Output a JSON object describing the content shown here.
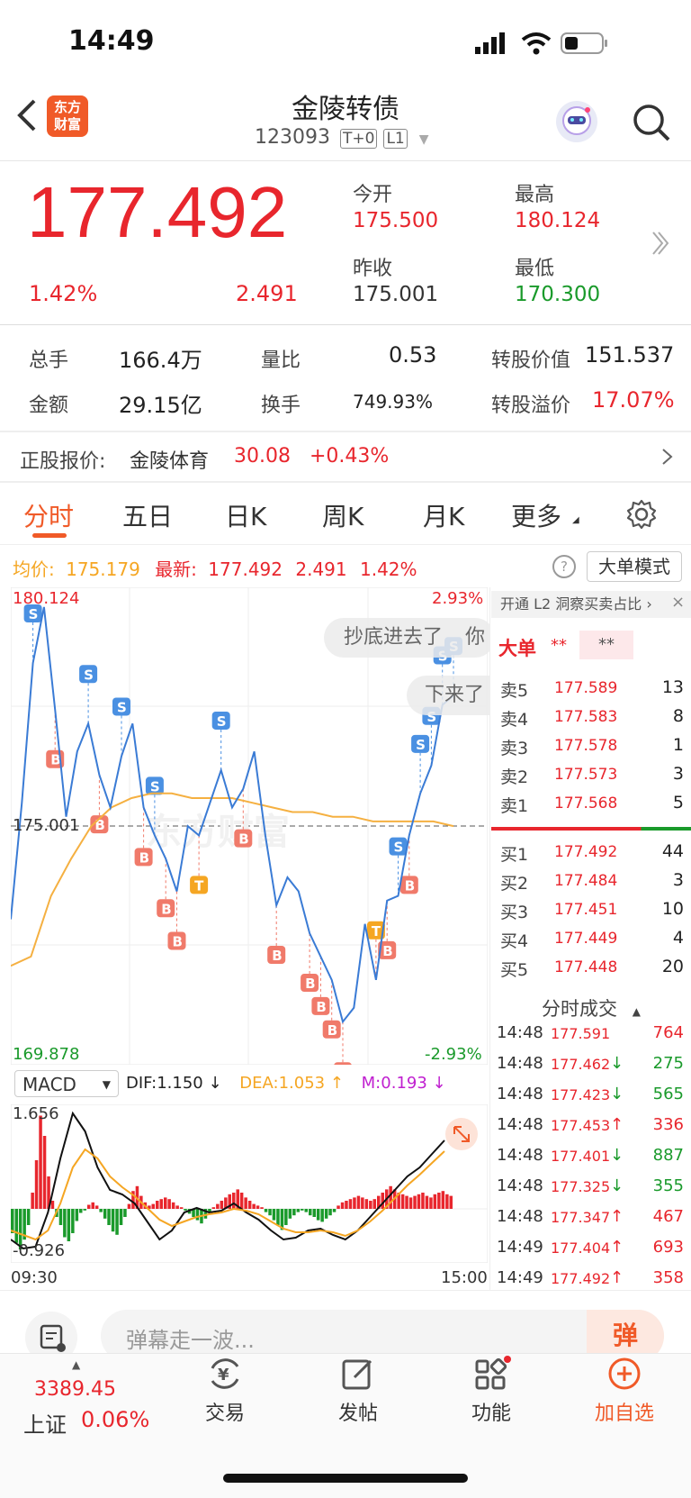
{
  "status_bar": {
    "time": "14:49"
  },
  "header": {
    "logo_line1": "东方",
    "logo_line2": "财富",
    "title": "金陵转债",
    "code": "123093",
    "tag1": "T+0",
    "tag2": "L1"
  },
  "quote": {
    "price": "177.492",
    "change_pct": "1.42%",
    "change": "2.491",
    "open_label": "今开",
    "open": "175.500",
    "high_label": "最高",
    "high": "180.124",
    "prev_label": "昨收",
    "prev": "175.001",
    "low_label": "最低",
    "low": "170.300"
  },
  "stats": {
    "vol_label": "总手",
    "vol": "166.4万",
    "ratio_label": "量比",
    "ratio": "0.53",
    "conv_value_label": "转股价值",
    "conv_value": "151.537",
    "amount_label": "金额",
    "amount": "29.15亿",
    "turnover_label": "换手",
    "turnover": "749.93%",
    "premium_label": "转股溢价",
    "premium": "17.07%"
  },
  "stock": {
    "label": "正股报价:",
    "name": "金陵体育",
    "price": "30.08",
    "change": "+0.43%"
  },
  "tabs": [
    "分时",
    "五日",
    "日K",
    "周K",
    "月K",
    "更多"
  ],
  "info_line": {
    "avg_label": "均价:",
    "avg": "175.179",
    "latest_label": "最新:",
    "latest": "177.492",
    "change": "2.491",
    "pct": "1.42%",
    "mode_button": "大单模式"
  },
  "chart_labels": {
    "top_price": "180.124",
    "top_pct": "2.93%",
    "mid_price": "175.001",
    "bottom_price": "169.878",
    "bottom_pct": "-2.93%",
    "danmu1": "抄底进去了",
    "danmu1_tail": "你",
    "danmu2": "下来了",
    "watermark": "东方财富"
  },
  "chart_data": {
    "type": "line",
    "title": "",
    "x_range": [
      "09:30",
      "15:00"
    ],
    "ylim": [
      169.878,
      180.124
    ],
    "prev_close": 175.001,
    "series": [
      {
        "name": "",
        "values": [
          173.0,
          175.5,
          178.5,
          179.7,
          177.5,
          175.2,
          176.6,
          177.2,
          176.1,
          175.4,
          176.5,
          177.2,
          175.4,
          174.8,
          174.3,
          173.6,
          175.0,
          174.8,
          175.5,
          176.2,
          175.4,
          175.8,
          176.6,
          174.8,
          173.3,
          173.9,
          173.6,
          172.7,
          172.2,
          171.7,
          170.8,
          171.1,
          172.9,
          171.7,
          173.4,
          173.5,
          174.8,
          175.7,
          176.3,
          177.6,
          177.8
        ]
      },
      {
        "name": "",
        "values": [
          172.0,
          172.2,
          173.5,
          174.3,
          175.0,
          175.4,
          175.6,
          175.7,
          175.7,
          175.6,
          175.6,
          175.6,
          175.5,
          175.4,
          175.3,
          175.3,
          175.2,
          175.2,
          175.1,
          175.1,
          175.1,
          175.1,
          175.0
        ]
      }
    ]
  },
  "macd": {
    "label": "MACD",
    "dif_label": "DIF:",
    "dif": "1.150",
    "dea_label": "DEA:",
    "dea": "1.053",
    "m_label": "M:",
    "m": "0.193",
    "top": "1.656",
    "bottom": "-0.926",
    "time_start": "09:30",
    "time_end": "15:00"
  },
  "orderbook": {
    "banner": "开通 L2 洞察买卖占比",
    "big_label": "大单",
    "big_val1": "**",
    "big_val2": "**",
    "asks": [
      {
        "label": "卖5",
        "price": "177.589",
        "vol": "13"
      },
      {
        "label": "卖4",
        "price": "177.583",
        "vol": "8"
      },
      {
        "label": "卖3",
        "price": "177.578",
        "vol": "1"
      },
      {
        "label": "卖2",
        "price": "177.573",
        "vol": "3"
      },
      {
        "label": "卖1",
        "price": "177.568",
        "vol": "5"
      }
    ],
    "bids": [
      {
        "label": "买1",
        "price": "177.492",
        "vol": "44"
      },
      {
        "label": "买2",
        "price": "177.484",
        "vol": "3"
      },
      {
        "label": "买3",
        "price": "177.451",
        "vol": "10"
      },
      {
        "label": "买4",
        "price": "177.449",
        "vol": "4"
      },
      {
        "label": "买5",
        "price": "177.448",
        "vol": "20"
      }
    ],
    "trades_title": "分时成交",
    "trades": [
      {
        "time": "14:48",
        "price": "177.591",
        "dir": "",
        "vol": "764"
      },
      {
        "time": "14:48",
        "price": "177.462",
        "dir": "↓",
        "vol": "275"
      },
      {
        "time": "14:48",
        "price": "177.423",
        "dir": "↓",
        "vol": "565"
      },
      {
        "time": "14:48",
        "price": "177.453",
        "dir": "↑",
        "vol": "336"
      },
      {
        "time": "14:48",
        "price": "177.401",
        "dir": "↓",
        "vol": "887"
      },
      {
        "time": "14:48",
        "price": "177.325",
        "dir": "↓",
        "vol": "355"
      },
      {
        "time": "14:48",
        "price": "177.347",
        "dir": "↑",
        "vol": "467"
      },
      {
        "time": "14:49",
        "price": "177.404",
        "dir": "↑",
        "vol": "693"
      },
      {
        "time": "14:49",
        "price": "177.492",
        "dir": "↑",
        "vol": "358"
      }
    ]
  },
  "comment": {
    "placeholder": "弹幕走一波...",
    "danmu_button": "弹"
  },
  "bottom_nav": {
    "index_value": "3389.45",
    "index_name": "上证",
    "index_pct": "0.06%",
    "trade": "交易",
    "post": "发帖",
    "func": "功能",
    "watch": "加自选"
  }
}
